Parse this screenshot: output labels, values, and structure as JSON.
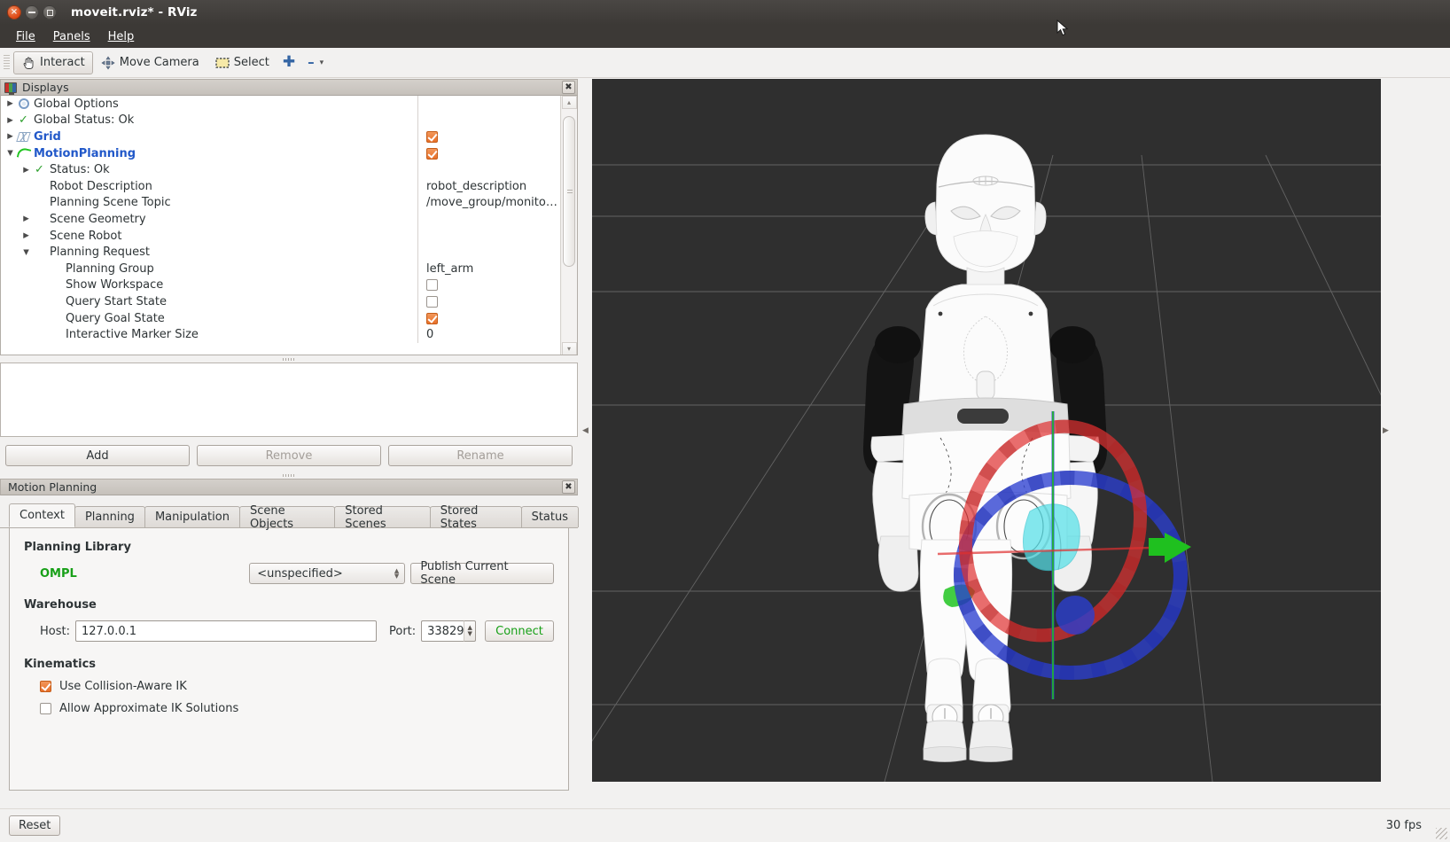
{
  "window": {
    "title": "moveit.rviz* - RViz",
    "close_glyph": "×",
    "minimize_glyph": "–",
    "maximize_glyph": "□"
  },
  "menubar": {
    "items": [
      {
        "label": "File",
        "mnemonic": "F"
      },
      {
        "label": "Panels",
        "mnemonic": "P"
      },
      {
        "label": "Help",
        "mnemonic": "H"
      }
    ]
  },
  "toolbar": {
    "interact_label": "Interact",
    "move_camera_label": "Move Camera",
    "select_label": "Select",
    "add_tool_glyph": "✚",
    "remove_tool_glyph": "–",
    "overflow_glyph": "▾"
  },
  "displays_panel": {
    "title": "Displays",
    "close_glyph": "✖",
    "scroll_up_glyph": "▴",
    "scroll_down_glyph": "▾",
    "rows": [
      {
        "indent": 0,
        "arrow": "▶",
        "icon": "gear-icon",
        "label": "Global Options",
        "bold": false,
        "value": "",
        "value_type": "text"
      },
      {
        "indent": 0,
        "arrow": "▶",
        "icon": "status-ok-check-icon",
        "label": "Global Status: Ok",
        "bold": false,
        "value": "",
        "value_type": "text"
      },
      {
        "indent": 0,
        "arrow": "▶",
        "icon": "grid-icon",
        "label": "Grid",
        "bold": true,
        "value": "checked",
        "value_type": "checkbox"
      },
      {
        "indent": 0,
        "arrow": "▼",
        "icon": "motion-planning-icon",
        "label": "MotionPlanning",
        "bold": true,
        "value": "checked",
        "value_type": "checkbox"
      },
      {
        "indent": 1,
        "arrow": "▶",
        "icon": "status-ok-check-icon",
        "label": "Status: Ok",
        "bold": false,
        "value": "",
        "value_type": "text"
      },
      {
        "indent": 1,
        "arrow": "",
        "icon": "",
        "label": "Robot Description",
        "bold": false,
        "value": "robot_description",
        "value_type": "text"
      },
      {
        "indent": 1,
        "arrow": "",
        "icon": "",
        "label": "Planning Scene Topic",
        "bold": false,
        "value": "/move_group/monito…",
        "value_type": "text"
      },
      {
        "indent": 1,
        "arrow": "▶",
        "icon": "",
        "label": "Scene Geometry",
        "bold": false,
        "value": "",
        "value_type": "text"
      },
      {
        "indent": 1,
        "arrow": "▶",
        "icon": "",
        "label": "Scene Robot",
        "bold": false,
        "value": "",
        "value_type": "text"
      },
      {
        "indent": 1,
        "arrow": "▼",
        "icon": "",
        "label": "Planning Request",
        "bold": false,
        "value": "",
        "value_type": "text"
      },
      {
        "indent": 2,
        "arrow": "",
        "icon": "",
        "label": "Planning Group",
        "bold": false,
        "value": "left_arm",
        "value_type": "text"
      },
      {
        "indent": 2,
        "arrow": "",
        "icon": "",
        "label": "Show Workspace",
        "bold": false,
        "value": "unchecked",
        "value_type": "checkbox"
      },
      {
        "indent": 2,
        "arrow": "",
        "icon": "",
        "label": "Query Start State",
        "bold": false,
        "value": "unchecked",
        "value_type": "checkbox"
      },
      {
        "indent": 2,
        "arrow": "",
        "icon": "",
        "label": "Query Goal State",
        "bold": false,
        "value": "checked",
        "value_type": "checkbox"
      },
      {
        "indent": 2,
        "arrow": "",
        "icon": "",
        "label": "Interactive Marker Size",
        "bold": false,
        "value": "0",
        "value_type": "text"
      }
    ],
    "buttons": {
      "add": "Add",
      "remove": "Remove",
      "rename": "Rename"
    }
  },
  "motion_planning_panel": {
    "title": "Motion Planning",
    "close_glyph": "✖",
    "tabs": [
      {
        "label": "Context",
        "active": true
      },
      {
        "label": "Planning",
        "active": false
      },
      {
        "label": "Manipulation",
        "active": false
      },
      {
        "label": "Scene Objects",
        "active": false
      },
      {
        "label": "Stored Scenes",
        "active": false
      },
      {
        "label": "Stored States",
        "active": false
      },
      {
        "label": "Status",
        "active": false
      }
    ],
    "context": {
      "planning_library_heading": "Planning Library",
      "library_name": "OMPL",
      "planner_combo_value": "<unspecified>",
      "publish_scene_button": "Publish Current Scene",
      "publish_scene_mnemonic": "P",
      "warehouse_heading": "Warehouse",
      "host_label": "Host:",
      "host_value": "127.0.0.1",
      "port_label": "Port:",
      "port_value": "33829",
      "connect_button": "Connect",
      "kinematics_heading": "Kinematics",
      "use_collision_aware_ik_label": "Use Collision-Aware IK",
      "use_collision_aware_ik_state": "checked",
      "allow_approximate_ik_label": "Allow Approximate IK Solutions",
      "allow_approximate_ik_state": "unchecked"
    }
  },
  "viewport": {
    "background_color": "#2f2f2f",
    "grid_color": "#9a9a9a",
    "robot_body_color": "#fbfbfb",
    "robot_arm_color": "#181818",
    "marker_x_axis_color": "#e03030",
    "marker_y_axis_color": "#1fc01f",
    "marker_z_axis_color": "#2b3fd0",
    "goal_state_highlight_color": "#55e0e8"
  },
  "statusbar": {
    "reset_button": "Reset",
    "fps": "30 fps"
  }
}
